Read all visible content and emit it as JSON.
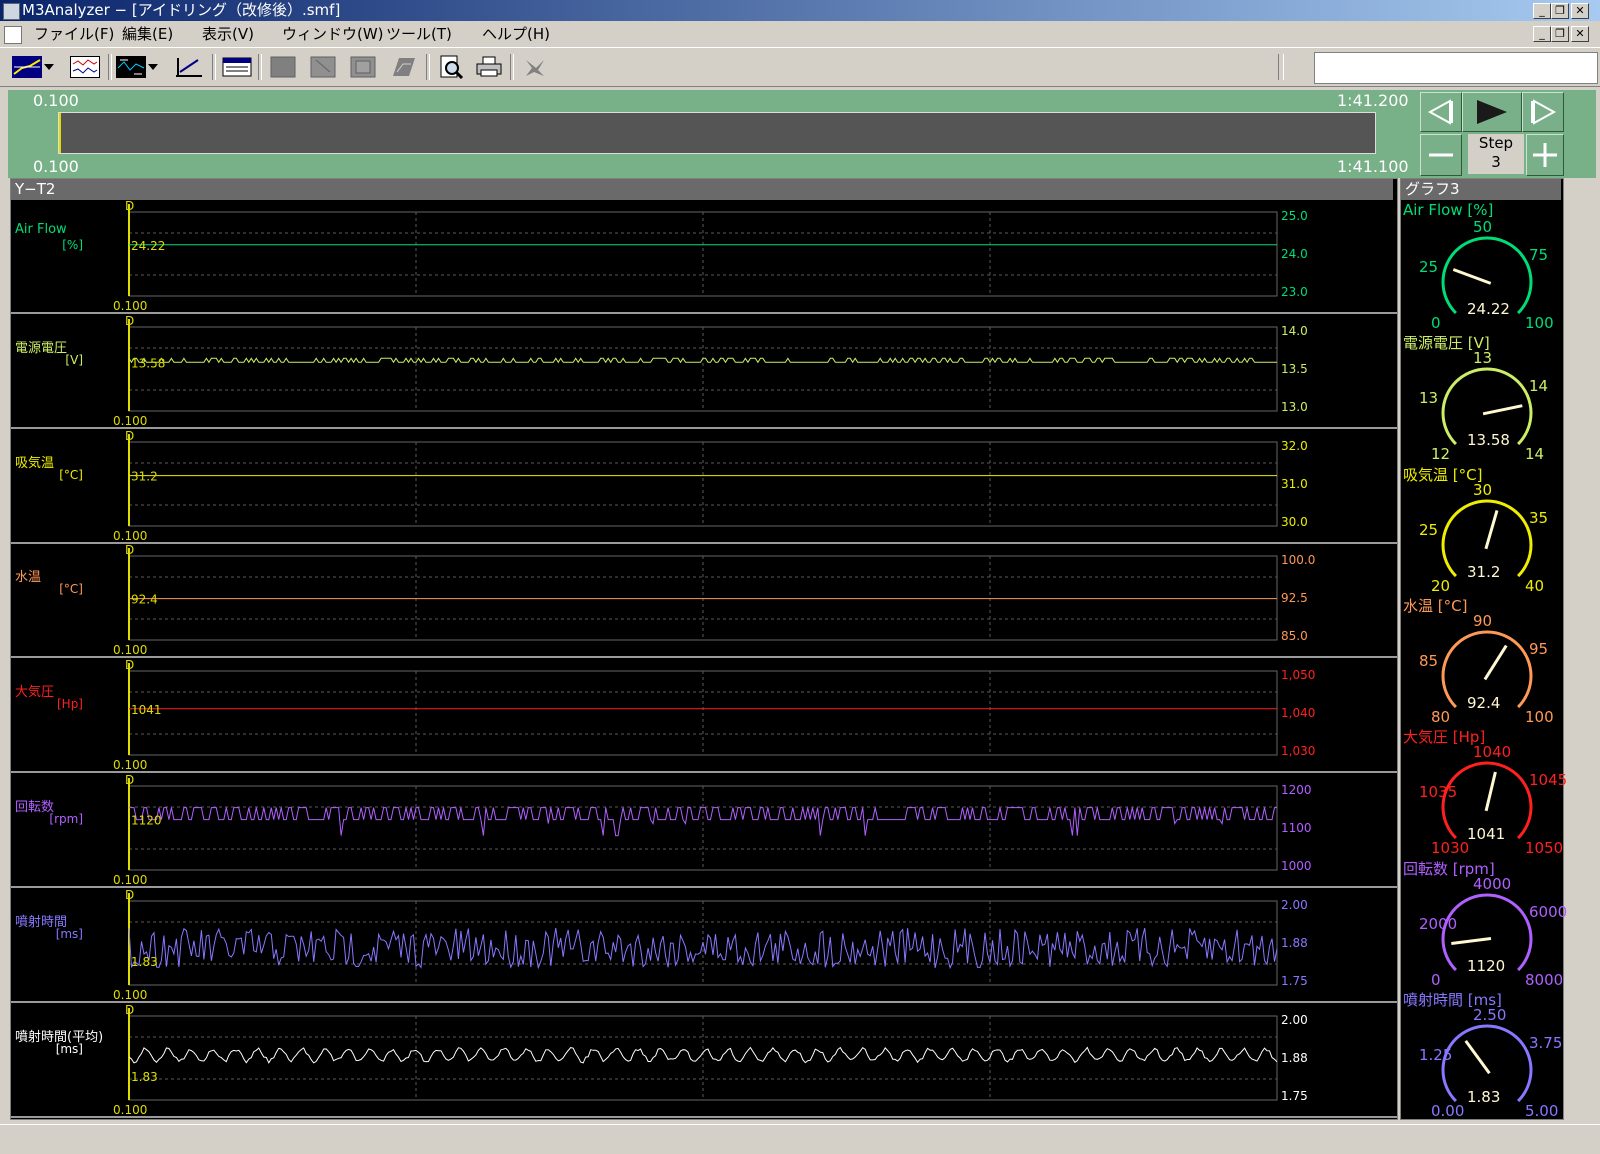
{
  "window": {
    "title": "M3Analyzer − [アイドリング（改修後）.smf]",
    "min": "_",
    "restore": "❐",
    "close": "✕"
  },
  "menu": [
    "ファイル(F)",
    "編集(E)",
    "表示(V)",
    "ウィンドウ(W)",
    "ツール(T)",
    "ヘルプ(H)"
  ],
  "timebar": {
    "start_top": "0.100",
    "end_top": "1:41.200",
    "start_bottom": "0.100",
    "end_bottom": "1:41.100",
    "step_label": "Step",
    "step_value": "3"
  },
  "yt_panel": {
    "title": "Y−T2",
    "x_start": "0.100",
    "channels": [
      {
        "id": "airflow",
        "name": "Air Flow",
        "unit": "[%]",
        "color": "#00dd77",
        "ticks": [
          "25.0",
          "24.0",
          "23.0"
        ],
        "min": 23.0,
        "max": 25.0,
        "value": "24.22",
        "value_num": 24.22,
        "signal": "flat"
      },
      {
        "id": "voltage",
        "name": "電源電圧",
        "unit": "[V]",
        "color": "#ccee66",
        "ticks": [
          "14.0",
          "13.5",
          "13.0"
        ],
        "min": 13.0,
        "max": 14.0,
        "value": "13.58",
        "value_num": 13.58,
        "signal": "step_small"
      },
      {
        "id": "intake_temp",
        "name": "吸気温",
        "unit": "[°C]",
        "color": "#eeee00",
        "ticks": [
          "32.0",
          "31.0",
          "30.0"
        ],
        "min": 30.0,
        "max": 32.0,
        "value": "31.2",
        "value_num": 31.2,
        "signal": "flat"
      },
      {
        "id": "water_temp",
        "name": "水温",
        "unit": "[°C]",
        "color": "#ff9955",
        "ticks": [
          "100.0",
          "92.5",
          "85.0"
        ],
        "min": 85.0,
        "max": 100.0,
        "value": "92.4",
        "value_num": 92.4,
        "signal": "flat"
      },
      {
        "id": "pressure",
        "name": "大気圧",
        "unit": "[Hp]",
        "color": "#ff2020",
        "ticks": [
          "1,050",
          "1,040",
          "1,030"
        ],
        "min": 1030,
        "max": 1050,
        "value": "1041",
        "value_num": 1041,
        "signal": "flat"
      },
      {
        "id": "rpm",
        "name": "回転数",
        "unit": "[rpm]",
        "color": "#b060ff",
        "ticks": [
          "1200",
          "1100",
          "1000"
        ],
        "min": 1000,
        "max": 1200,
        "value": "1120",
        "value_num": 1120,
        "signal": "step_rpm"
      },
      {
        "id": "inj",
        "name": "噴射時間",
        "unit": "[ms]",
        "color": "#8877ff",
        "ticks": [
          "2.00",
          "1.88",
          "1.75"
        ],
        "min": 1.75,
        "max": 2.0,
        "value": "1.83",
        "value_num": 1.83,
        "signal": "noise"
      },
      {
        "id": "inj_avg",
        "name": "噴射時間(平均)",
        "unit": "[ms]",
        "color": "#ffffff",
        "ticks": [
          "2.00",
          "1.88",
          "1.75"
        ],
        "min": 1.75,
        "max": 2.0,
        "value": "1.83",
        "value_num": 1.83,
        "signal": "smooth"
      }
    ]
  },
  "gauge_panel": {
    "title": "グラフ3",
    "gauges": [
      {
        "id": "airflow",
        "label": "Air Flow [%]",
        "color": "#00dd77",
        "min": "0",
        "q1": "25",
        "mid": "50",
        "q3": "75",
        "max": "100",
        "min_num": 0,
        "max_num": 100,
        "value": "24.22",
        "value_num": 24.22
      },
      {
        "id": "voltage",
        "label": "電源電圧 [V]",
        "color": "#ccee66",
        "min": "12",
        "q1": "13",
        "mid": "13",
        "q3": "14",
        "max": "14",
        "min_num": 12,
        "max_num": 14,
        "value": "13.58",
        "value_num": 13.58
      },
      {
        "id": "intake_temp",
        "label": "吸気温 [°C]",
        "color": "#eeee00",
        "min": "20",
        "q1": "25",
        "mid": "30",
        "q3": "35",
        "max": "40",
        "min_num": 20,
        "max_num": 40,
        "value": "31.2",
        "value_num": 31.2
      },
      {
        "id": "water_temp",
        "label": "水温 [°C]",
        "color": "#ff9955",
        "min": "80",
        "q1": "85",
        "mid": "90",
        "q3": "95",
        "max": "100",
        "min_num": 80,
        "max_num": 100,
        "value": "92.4",
        "value_num": 92.4
      },
      {
        "id": "pressure",
        "label": "大気圧 [Hp]",
        "color": "#ff2020",
        "min": "1030",
        "q1": "1035",
        "mid": "1040",
        "q3": "1045",
        "max": "1050",
        "min_num": 1030,
        "max_num": 1050,
        "value": "1041",
        "value_num": 1041
      },
      {
        "id": "rpm",
        "label": "回転数 [rpm]",
        "color": "#b060ff",
        "min": "0",
        "q1": "2000",
        "mid": "4000",
        "q3": "6000",
        "max": "8000",
        "min_num": 0,
        "max_num": 8000,
        "value": "1120",
        "value_num": 1120
      },
      {
        "id": "inj",
        "label": "噴射時間 [ms]",
        "color": "#8877ff",
        "min": "0.00",
        "q1": "1.25",
        "mid": "2.50",
        "q3": "3.75",
        "max": "5.00",
        "min_num": 0,
        "max_num": 5,
        "value": "1.83",
        "value_num": 1.83
      }
    ]
  }
}
